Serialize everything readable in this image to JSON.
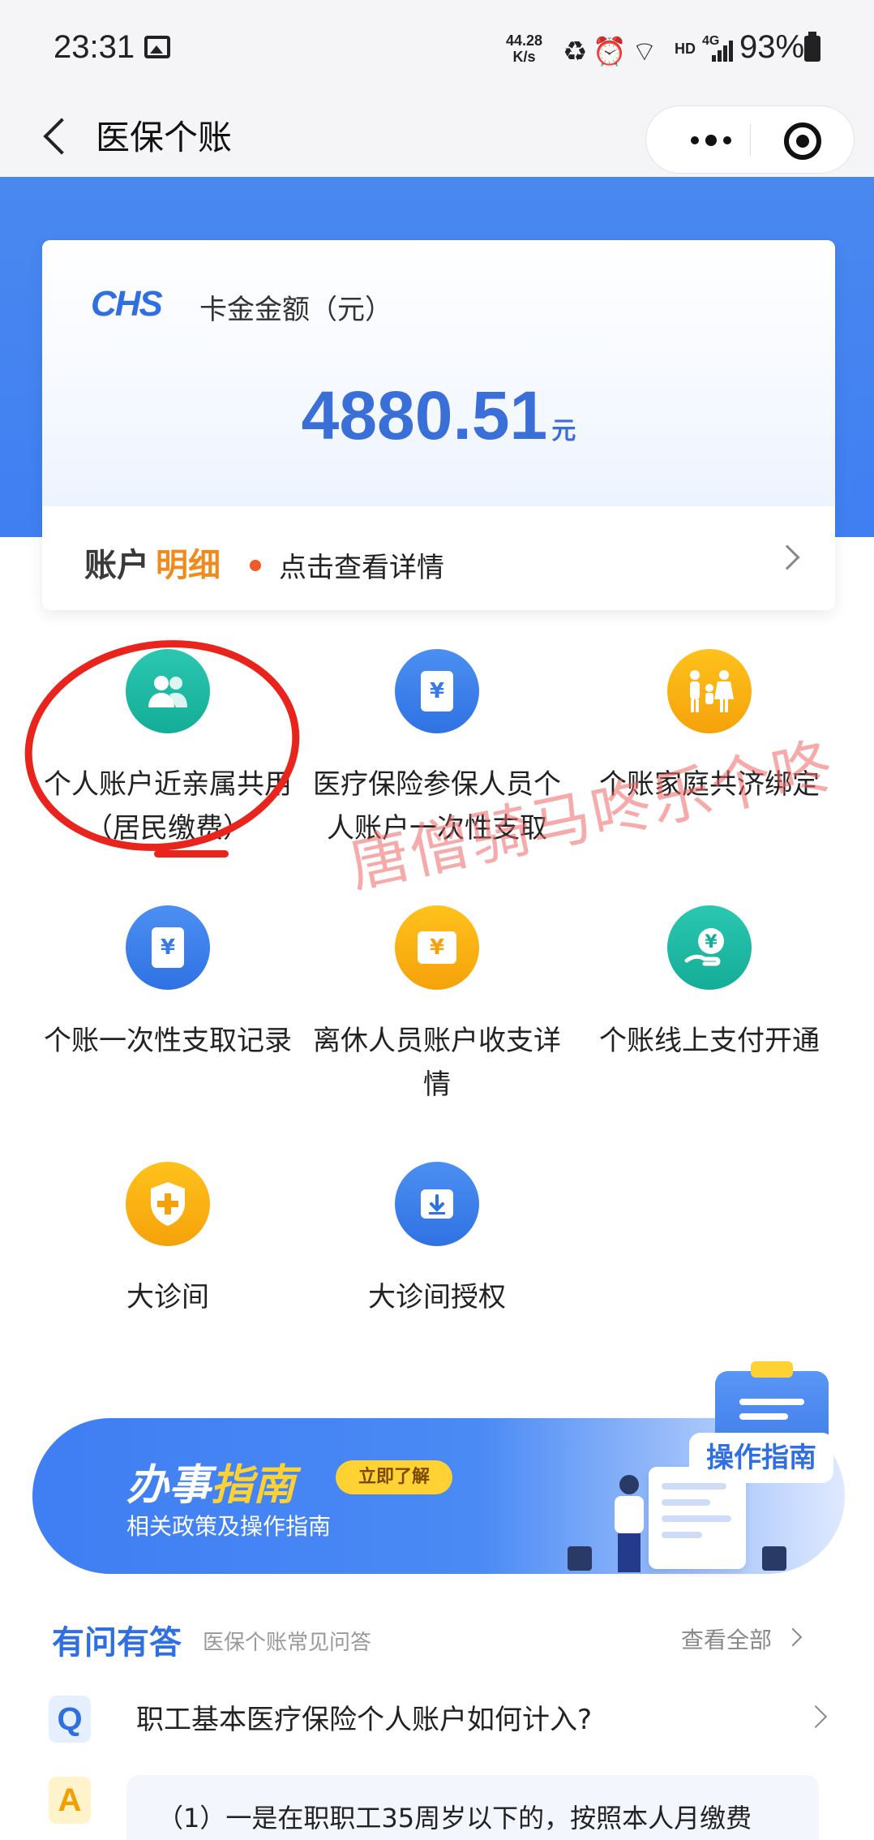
{
  "status_bar": {
    "time": "23:31",
    "speed_value": "44.28",
    "speed_unit": "K/s",
    "hd": "HD",
    "network": "4G",
    "battery": "93%"
  },
  "nav": {
    "title": "医保个账"
  },
  "balance_card": {
    "logo": "CHS",
    "label": "卡金金额（元）",
    "amount": "4880.51",
    "unit": "元",
    "detail_part1": "账户",
    "detail_part2": "明细",
    "detail_hint": "点击查看详情"
  },
  "services": [
    {
      "label": "个人账户近亲属共用（居民缴费）",
      "icon": "family-share-icon"
    },
    {
      "label": "医疗保险参保人员个人账户一次性支取",
      "icon": "yuan-card-icon"
    },
    {
      "label": "个账家庭共济绑定",
      "icon": "family-icon"
    },
    {
      "label": "个账一次性支取记录",
      "icon": "yuan-record-icon"
    },
    {
      "label": "离休人员账户收支详情",
      "icon": "wallet-icon"
    },
    {
      "label": "个账线上支付开通",
      "icon": "hand-yuan-icon"
    },
    {
      "label": "大诊间",
      "icon": "shield-plus-icon"
    },
    {
      "label": "大诊间授权",
      "icon": "download-box-icon"
    }
  ],
  "watermark": "唐僧骑马咚乐个咚",
  "banner": {
    "title_part1": "办事",
    "title_part2": "指南",
    "button": "立即了解",
    "subtitle": "相关政策及操作指南",
    "tag": "操作指南"
  },
  "faq": {
    "title": "有问有答",
    "subtitle": "医保个账常见问答",
    "view_all": "查看全部",
    "q_badge": "Q",
    "question": "职工基本医疗保险个人账户如何计入?",
    "a_badge": "A",
    "answer": "（1）一是在职职工35周岁以下的，按照本人月缴费"
  },
  "colors": {
    "primary_blue": "#3f7ff2",
    "orange": "#f5a20a",
    "teal": "#14ad97",
    "annotation_red": "#e8241c"
  }
}
